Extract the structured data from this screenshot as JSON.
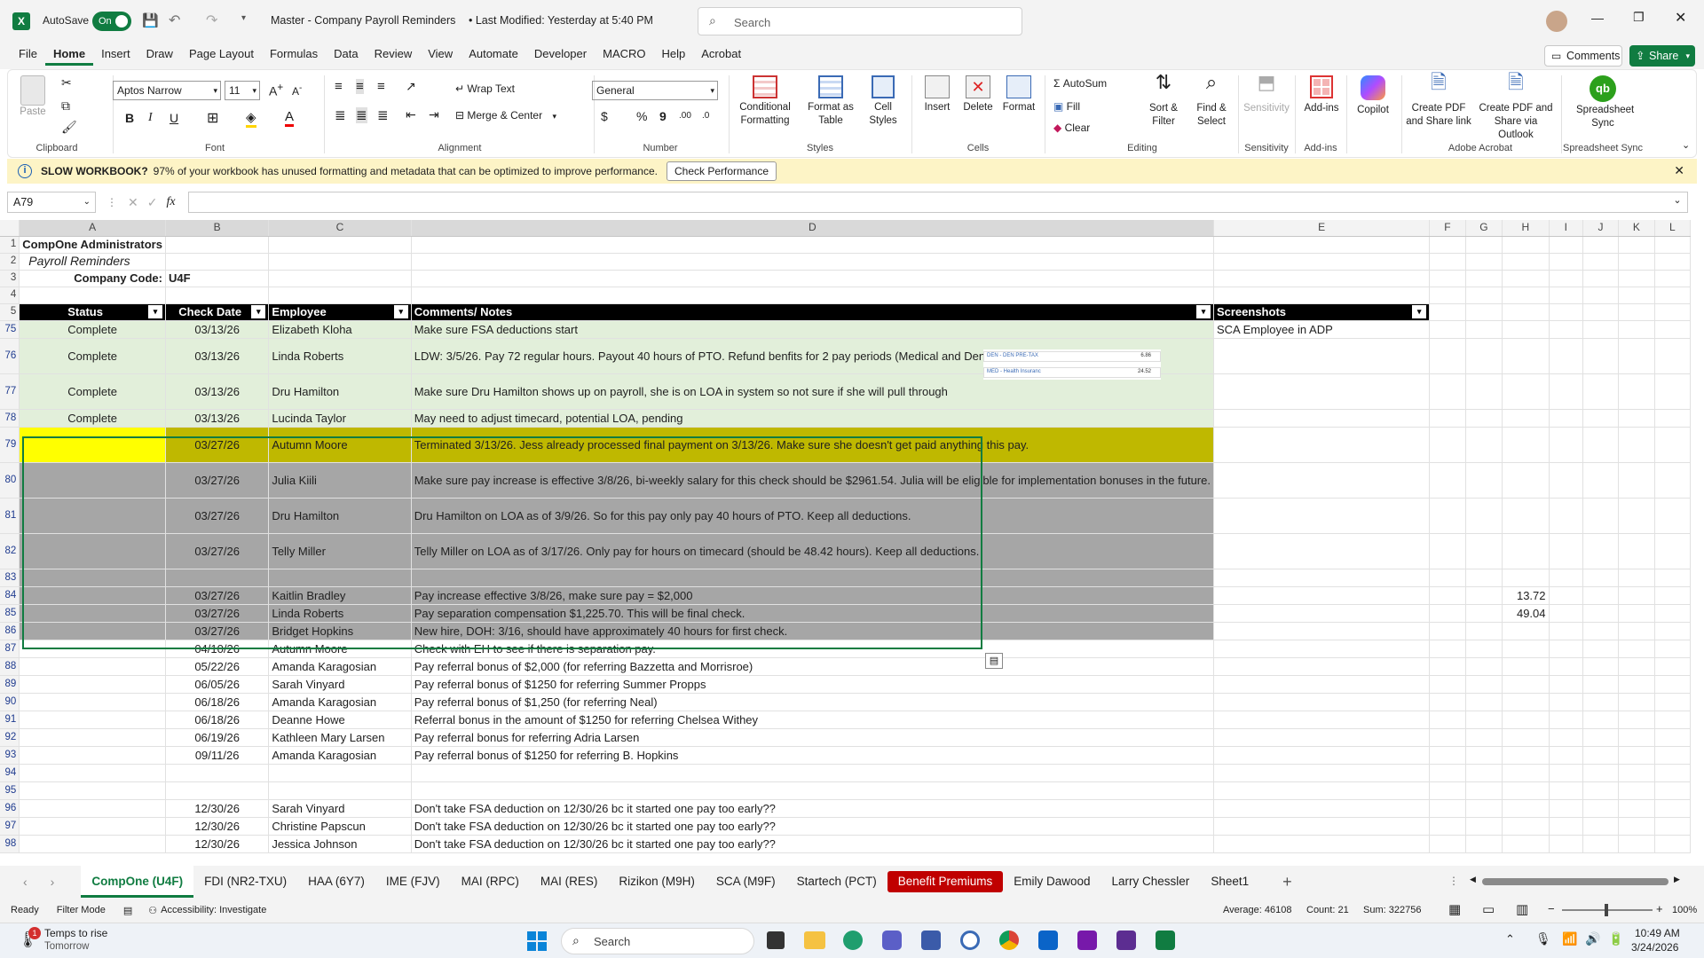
{
  "titlebar": {
    "autosave_label": "AutoSave",
    "autosave_state": "On",
    "doc_title": "Master - Company Payroll Reminders",
    "modified": "• Last Modified: Yesterday at 5:40 PM",
    "search_placeholder": "Search"
  },
  "menu": [
    "File",
    "Home",
    "Insert",
    "Draw",
    "Page Layout",
    "Formulas",
    "Data",
    "Review",
    "View",
    "Automate",
    "Developer",
    "MACRO",
    "Help",
    "Acrobat"
  ],
  "menu_right": {
    "comments": "Comments",
    "share": "Share"
  },
  "ribbon": {
    "clipboard": {
      "paste": "Paste",
      "group": "Clipboard"
    },
    "font": {
      "name": "Aptos Narrow",
      "size": "11",
      "group": "Font"
    },
    "alignment": {
      "wrap": "Wrap Text",
      "merge": "Merge & Center",
      "group": "Alignment"
    },
    "number": {
      "format": "General",
      "group": "Number"
    },
    "styles": {
      "cond": "Conditional Formatting",
      "table": "Format as Table",
      "cell": "Cell Styles",
      "group": "Styles"
    },
    "cells": {
      "insert": "Insert",
      "delete": "Delete",
      "format": "Format",
      "group": "Cells"
    },
    "editing": {
      "autosum": "AutoSum",
      "fill": "Fill",
      "clear": "Clear",
      "sort": "Sort & Filter",
      "find": "Find & Select",
      "group": "Editing"
    },
    "sensitivity": {
      "label": "Sensitivity",
      "group": "Sensitivity"
    },
    "addins": {
      "label": "Add-ins",
      "group": "Add-ins"
    },
    "copilot": {
      "label": "Copilot"
    },
    "acrobat": {
      "pdf_link": "Create PDF and Share link",
      "pdf_outlook": "Create PDF and Share via Outlook",
      "group": "Adobe Acrobat"
    },
    "sync": {
      "label": "Spreadsheet Sync",
      "group": "Spreadsheet Sync"
    }
  },
  "message": {
    "title": "SLOW WORKBOOK?",
    "text": "97% of your workbook has unused formatting and metadata that can be optimized to improve performance.",
    "button": "Check Performance"
  },
  "formula": {
    "namebox": "A79",
    "fx": "fx",
    "value": ""
  },
  "columns": [
    "A",
    "B",
    "C",
    "D",
    "E",
    "F",
    "G",
    "H",
    "I",
    "J",
    "K",
    "L"
  ],
  "sheet": {
    "title": "CompOne Administrators",
    "subtitle": "Payroll Reminders",
    "code_label": "Company Code:",
    "code_value": "U4F",
    "headers": {
      "status": "Status",
      "date": "Check Date",
      "employee": "Employee",
      "comments": "Comments/ Notes",
      "screenshots": "Screenshots"
    },
    "rows": [
      {
        "n": "75",
        "status": "Complete",
        "date": "03/13/26",
        "emp": "Elizabeth Kloha",
        "note": "Make sure FSA deductions start",
        "shot": "SCA Employee in ADP",
        "h": "",
        "style": "gr",
        "ht": 20
      },
      {
        "n": "76",
        "status": "Complete",
        "date": "03/13/26",
        "emp": "Linda Roberts",
        "note": "LDW: 3/5/26. Pay 72 regular hours. Payout 40 hours of PTO. Refund benfits for 2 pay periods (Medical and Dental) totaling $62.76.",
        "shot": "",
        "h": "",
        "style": "gr",
        "ht": 40
      },
      {
        "n": "77",
        "status": "Complete",
        "date": "03/13/26",
        "emp": "Dru Hamilton",
        "note": "Make sure Dru Hamilton shows up on payroll, she is on LOA in system so not sure if she will pull through",
        "shot": "",
        "h": "",
        "style": "gr",
        "ht": 40
      },
      {
        "n": "78",
        "status": "Complete",
        "date": "03/13/26",
        "emp": "Lucinda Taylor",
        "note": "May need to adjust timecard, potential LOA, pending",
        "shot": "",
        "h": "",
        "style": "gr",
        "ht": 20
      },
      {
        "n": "79",
        "status": "",
        "date": "03/27/26",
        "emp": "Autumn Moore",
        "note": "Terminated 3/13/26. Jess already processed final payment on 3/13/26. Make sure she doesn't get paid anything this pay.",
        "shot": "",
        "h": "",
        "style": "yl",
        "ht": 40
      },
      {
        "n": "80",
        "status": "",
        "date": "03/27/26",
        "emp": "Julia Kiili",
        "note": "Make sure pay increase is effective 3/8/26, bi-weekly salary for this check should be $2961.54. Julia will be eligible for implementation bonuses in the future.",
        "shot": "",
        "h": "",
        "style": "gy",
        "ht": 40
      },
      {
        "n": "81",
        "status": "",
        "date": "03/27/26",
        "emp": "Dru Hamilton",
        "note": "Dru Hamilton on LOA as of 3/9/26. So for this pay only pay 40 hours of PTO. Keep all deductions.",
        "shot": "",
        "h": "",
        "style": "gy",
        "ht": 40
      },
      {
        "n": "82",
        "status": "",
        "date": "03/27/26",
        "emp": "Telly Miller",
        "note": "Telly Miller on LOA as of 3/17/26. Only pay for hours on timecard (should be 48.42 hours). Keep all deductions.",
        "shot": "",
        "h": "",
        "style": "gy",
        "ht": 40
      },
      {
        "n": "83",
        "status": "",
        "date": "",
        "emp": "",
        "note": "",
        "shot": "",
        "h": "",
        "style": "gy",
        "ht": 20
      },
      {
        "n": "84",
        "status": "",
        "date": "03/27/26",
        "emp": "Kaitlin Bradley",
        "note": "Pay increase effective 3/8/26, make sure pay = $2,000",
        "shot": "",
        "h": "13.72",
        "style": "gy",
        "ht": 20
      },
      {
        "n": "85",
        "status": "",
        "date": "03/27/26",
        "emp": "Linda Roberts",
        "note": "Pay separation compensation $1,225.70. This will be final check.",
        "shot": "",
        "h": "49.04",
        "style": "gy",
        "ht": 20
      },
      {
        "n": "86",
        "status": "",
        "date": "03/27/26",
        "emp": "Bridget Hopkins",
        "note": "New hire, DOH: 3/16, should have approximately 40 hours for first check.",
        "shot": "",
        "h": "",
        "style": "gy",
        "ht": 20
      },
      {
        "n": "87",
        "status": "",
        "date": "04/10/26",
        "emp": "Autumn Moore",
        "note": "Check with EH to see if there is separation pay.",
        "shot": "",
        "h": "",
        "style": "",
        "ht": 20
      },
      {
        "n": "88",
        "status": "",
        "date": "05/22/26",
        "emp": "Amanda Karagosian",
        "note": "Pay referral bonus of $2,000 (for referring Bazzetta and Morrisroe)",
        "shot": "",
        "h": "",
        "style": "",
        "ht": 20
      },
      {
        "n": "89",
        "status": "",
        "date": "06/05/26",
        "emp": "Sarah Vinyard",
        "note": "Pay referral bonus of $1250 for referring Summer Propps",
        "shot": "",
        "h": "",
        "style": "",
        "ht": 20
      },
      {
        "n": "90",
        "status": "",
        "date": "06/18/26",
        "emp": "Amanda Karagosian",
        "note": "Pay referral bonus of $1,250 (for referring Neal)",
        "shot": "",
        "h": "",
        "style": "",
        "ht": 20
      },
      {
        "n": "91",
        "status": "",
        "date": "06/18/26",
        "emp": "Deanne Howe",
        "note": "Referral bonus in the amount of $1250 for referring Chelsea Withey",
        "shot": "",
        "h": "",
        "style": "",
        "ht": 20
      },
      {
        "n": "92",
        "status": "",
        "date": "06/19/26",
        "emp": "Kathleen Mary Larsen",
        "note": "Pay referral bonus for referring Adria Larsen",
        "shot": "",
        "h": "",
        "style": "",
        "ht": 20
      },
      {
        "n": "93",
        "status": "",
        "date": "09/11/26",
        "emp": "Amanda Karagosian",
        "note": "Pay referral bonus of $1250 for referring B. Hopkins",
        "shot": "",
        "h": "",
        "style": "",
        "ht": 20
      },
      {
        "n": "94",
        "status": "",
        "date": "",
        "emp": "",
        "note": "",
        "shot": "",
        "h": "",
        "style": "",
        "ht": 20
      },
      {
        "n": "95",
        "status": "",
        "date": "",
        "emp": "",
        "note": "",
        "shot": "",
        "h": "",
        "style": "",
        "ht": 20
      },
      {
        "n": "96",
        "status": "",
        "date": "12/30/26",
        "emp": "Sarah Vinyard",
        "note": "Don't take FSA deduction on 12/30/26 bc it started one pay too early??",
        "shot": "",
        "h": "",
        "style": "",
        "ht": 20
      },
      {
        "n": "97",
        "status": "",
        "date": "12/30/26",
        "emp": "Christine Papscun",
        "note": "Don't take FSA deduction on 12/30/26 bc it started one pay too early??",
        "shot": "",
        "h": "",
        "style": "",
        "ht": 20
      },
      {
        "n": "98",
        "status": "",
        "date": "12/30/26",
        "emp": "Jessica Johnson",
        "note": "Don't take FSA deduction on 12/30/26 bc it started one pay too early??",
        "shot": "",
        "h": "",
        "style": "",
        "ht": 20
      }
    ],
    "thumbnail": {
      "line1_label": "DEN - DEN PRE-TAX",
      "line1_value": "6.86",
      "line2_label": "MED - Health Insuranc",
      "line2_value": "24.52"
    }
  },
  "tabs": [
    "CompOne (U4F)",
    "FDI (NR2-TXU)",
    "HAA (6Y7)",
    "IME (FJV)",
    "MAI (RPC)",
    "MAI (RES)",
    "Rizikon (M9H)",
    "SCA (M9F)",
    "Startech (PCT)",
    "Benefit Premiums",
    "Emily Dawood",
    "Larry Chessler",
    "Sheet1"
  ],
  "status": {
    "ready": "Ready",
    "filter": "Filter Mode",
    "accessibility": "Accessibility: Investigate",
    "average": "Average: 46108",
    "count": "Count: 21",
    "sum": "Sum: 322756",
    "zoom": "100%"
  },
  "taskbar": {
    "weather_title": "Temps to rise",
    "weather_sub": "Tomorrow",
    "search": "Search",
    "time": "10:49 AM",
    "date": "3/24/2026",
    "badge": "1"
  },
  "colors": {
    "excel_green": "#107c41",
    "row_green": "#e2efda",
    "row_yellow": "#bfb800",
    "row_gray": "#a6a6a6",
    "tab_red": "#c00000"
  }
}
